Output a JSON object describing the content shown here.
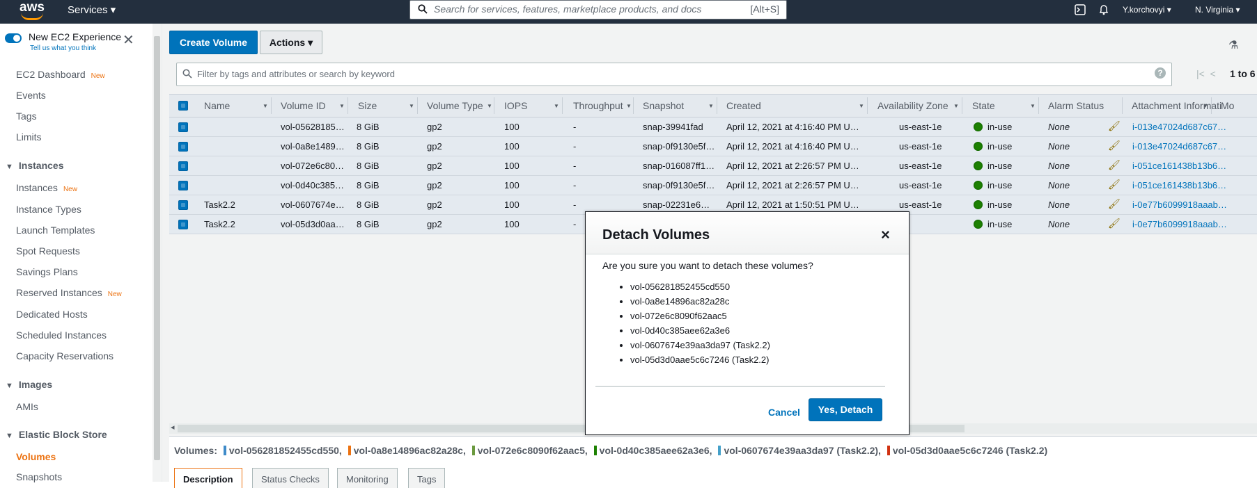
{
  "topnav": {
    "logo": "aws",
    "services_label": "Services ▾",
    "search_placeholder": "Search for services, features, marketplace products, and docs",
    "search_shortcut": "[Alt+S]",
    "user_label": "Y.korchovyi ▾",
    "region_label": "N. Virginia ▾"
  },
  "sidebar": {
    "new_experience_label": "New EC2 Experience",
    "tell_us_label": "Tell us what you think",
    "items": [
      {
        "label": "EC2 Dashboard",
        "badge": "New"
      },
      {
        "label": "Events",
        "badge": ""
      },
      {
        "label": "Tags",
        "badge": ""
      },
      {
        "label": "Limits",
        "badge": ""
      }
    ],
    "instances_section": "Instances",
    "instances_items": [
      {
        "label": "Instances",
        "badge": "New"
      },
      {
        "label": "Instance Types",
        "badge": ""
      },
      {
        "label": "Launch Templates",
        "badge": ""
      },
      {
        "label": "Spot Requests",
        "badge": ""
      },
      {
        "label": "Savings Plans",
        "badge": ""
      },
      {
        "label": "Reserved Instances",
        "badge": "New"
      },
      {
        "label": "Dedicated Hosts",
        "badge": ""
      },
      {
        "label": "Scheduled Instances",
        "badge": ""
      },
      {
        "label": "Capacity Reservations",
        "badge": ""
      }
    ],
    "images_section": "Images",
    "images_items": [
      {
        "label": "AMIs"
      }
    ],
    "ebs_section": "Elastic Block Store",
    "ebs_items": [
      {
        "label": "Volumes"
      },
      {
        "label": "Snapshots"
      }
    ]
  },
  "toolbar": {
    "create_volume": "Create Volume",
    "actions": "Actions"
  },
  "filter": {
    "placeholder": "Filter by tags and attributes or search by keyword",
    "help": "?",
    "pager_text": "1 to 6"
  },
  "table": {
    "columns": [
      "Name",
      "Volume ID",
      "Size",
      "Volume Type",
      "IOPS",
      "Throughput",
      "Snapshot",
      "Created",
      "Availability Zone",
      "State",
      "Alarm Status",
      "Attachment Informati",
      "Mo"
    ],
    "rows": [
      {
        "name": "",
        "volume_id": "vol-05628185…",
        "size": "8 GiB",
        "type": "gp2",
        "iops": "100",
        "throughput": "-",
        "snapshot": "snap-39941fad",
        "created": "April 12, 2021 at 4:16:40 PM U…",
        "az": "us-east-1e",
        "state": "in-use",
        "alarm": "None",
        "attachment": "i-013e47024d687c67…"
      },
      {
        "name": "",
        "volume_id": "vol-0a8e1489…",
        "size": "8 GiB",
        "type": "gp2",
        "iops": "100",
        "throughput": "-",
        "snapshot": "snap-0f9130e5f…",
        "created": "April 12, 2021 at 4:16:40 PM U…",
        "az": "us-east-1e",
        "state": "in-use",
        "alarm": "None",
        "attachment": "i-013e47024d687c67…"
      },
      {
        "name": "",
        "volume_id": "vol-072e6c80…",
        "size": "8 GiB",
        "type": "gp2",
        "iops": "100",
        "throughput": "-",
        "snapshot": "snap-016087ff1…",
        "created": "April 12, 2021 at 2:26:57 PM U…",
        "az": "us-east-1e",
        "state": "in-use",
        "alarm": "None",
        "attachment": "i-051ce161438b13b6…"
      },
      {
        "name": "",
        "volume_id": "vol-0d40c385…",
        "size": "8 GiB",
        "type": "gp2",
        "iops": "100",
        "throughput": "-",
        "snapshot": "snap-0f9130e5f…",
        "created": "April 12, 2021 at 2:26:57 PM U…",
        "az": "us-east-1e",
        "state": "in-use",
        "alarm": "None",
        "attachment": "i-051ce161438b13b6…"
      },
      {
        "name": "Task2.2",
        "volume_id": "vol-0607674e…",
        "size": "8 GiB",
        "type": "gp2",
        "iops": "100",
        "throughput": "-",
        "snapshot": "snap-02231e6…",
        "created": "April 12, 2021 at 1:50:51 PM U…",
        "az": "us-east-1e",
        "state": "in-use",
        "alarm": "None",
        "attachment": "i-0e77b6099918aaab…"
      },
      {
        "name": "Task2.2",
        "volume_id": "vol-05d3d0aa…",
        "size": "8 GiB",
        "type": "gp2",
        "iops": "100",
        "throughput": "-",
        "snapshot": "",
        "created": "",
        "az": "1e",
        "state": "in-use",
        "alarm": "None",
        "attachment": "i-0e77b6099918aaab…"
      }
    ]
  },
  "bottom": {
    "volumes_label": "Volumes:",
    "volumes": [
      {
        "text": "vol-056281852455cd550,",
        "color": "#3f8bc9"
      },
      {
        "text": "vol-0a8e14896ac82a28c,",
        "color": "#ec7211"
      },
      {
        "text": "vol-072e6c8090f62aac5,",
        "color": "#6b9a3f"
      },
      {
        "text": "vol-0d40c385aee62a3e6,",
        "color": "#1d8102"
      },
      {
        "text": "vol-0607674e39aa3da97 (Task2.2),",
        "color": "#44a0c9"
      },
      {
        "text": "vol-05d3d0aae5c6c7246 (Task2.2)",
        "color": "#d13212"
      }
    ],
    "tabs": [
      "Description",
      "Status Checks",
      "Monitoring",
      "Tags"
    ]
  },
  "modal": {
    "title": "Detach Volumes",
    "close": "×",
    "question": "Are you sure you want to detach these volumes?",
    "volumes": [
      "vol-056281852455cd550",
      "vol-0a8e14896ac82a28c",
      "vol-072e6c8090f62aac5",
      "vol-0d40c385aee62a3e6",
      "vol-0607674e39aa3da97 (Task2.2)",
      "vol-05d3d0aae5c6c7246 (Task2.2)"
    ],
    "cancel": "Cancel",
    "confirm": "Yes, Detach"
  }
}
